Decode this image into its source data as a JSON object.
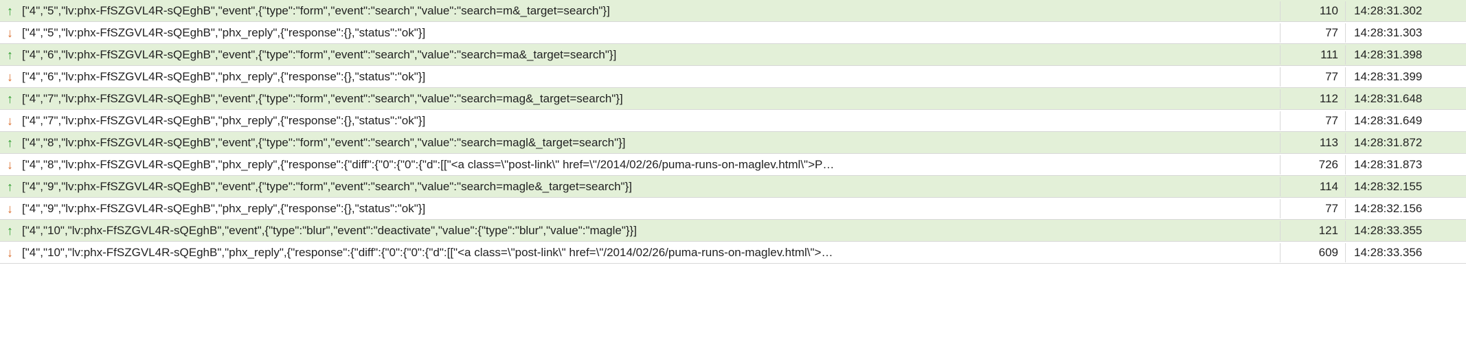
{
  "rows": [
    {
      "direction": "out",
      "arrow": "↑",
      "payload": "[\"4\",\"5\",\"lv:phx-FfSZGVL4R-sQEghB\",\"event\",{\"type\":\"form\",\"event\":\"search\",\"value\":\"search=m&_target=search\"}]",
      "size": "110",
      "time": "14:28:31.302"
    },
    {
      "direction": "in",
      "arrow": "↓",
      "payload": "[\"4\",\"5\",\"lv:phx-FfSZGVL4R-sQEghB\",\"phx_reply\",{\"response\":{},\"status\":\"ok\"}]",
      "size": "77",
      "time": "14:28:31.303"
    },
    {
      "direction": "out",
      "arrow": "↑",
      "payload": "[\"4\",\"6\",\"lv:phx-FfSZGVL4R-sQEghB\",\"event\",{\"type\":\"form\",\"event\":\"search\",\"value\":\"search=ma&_target=search\"}]",
      "size": "111",
      "time": "14:28:31.398"
    },
    {
      "direction": "in",
      "arrow": "↓",
      "payload": "[\"4\",\"6\",\"lv:phx-FfSZGVL4R-sQEghB\",\"phx_reply\",{\"response\":{},\"status\":\"ok\"}]",
      "size": "77",
      "time": "14:28:31.399"
    },
    {
      "direction": "out",
      "arrow": "↑",
      "payload": "[\"4\",\"7\",\"lv:phx-FfSZGVL4R-sQEghB\",\"event\",{\"type\":\"form\",\"event\":\"search\",\"value\":\"search=mag&_target=search\"}]",
      "size": "112",
      "time": "14:28:31.648"
    },
    {
      "direction": "in",
      "arrow": "↓",
      "payload": "[\"4\",\"7\",\"lv:phx-FfSZGVL4R-sQEghB\",\"phx_reply\",{\"response\":{},\"status\":\"ok\"}]",
      "size": "77",
      "time": "14:28:31.649"
    },
    {
      "direction": "out",
      "arrow": "↑",
      "payload": "[\"4\",\"8\",\"lv:phx-FfSZGVL4R-sQEghB\",\"event\",{\"type\":\"form\",\"event\":\"search\",\"value\":\"search=magl&_target=search\"}]",
      "size": "113",
      "time": "14:28:31.872"
    },
    {
      "direction": "in",
      "arrow": "↓",
      "payload": "[\"4\",\"8\",\"lv:phx-FfSZGVL4R-sQEghB\",\"phx_reply\",{\"response\":{\"diff\":{\"0\":{\"0\":{\"d\":[[\"<a class=\\\"post-link\\\" href=\\\"/2014/02/26/puma-runs-on-maglev.html\\\">P…",
      "size": "726",
      "time": "14:28:31.873"
    },
    {
      "direction": "out",
      "arrow": "↑",
      "payload": "[\"4\",\"9\",\"lv:phx-FfSZGVL4R-sQEghB\",\"event\",{\"type\":\"form\",\"event\":\"search\",\"value\":\"search=magle&_target=search\"}]",
      "size": "114",
      "time": "14:28:32.155"
    },
    {
      "direction": "in",
      "arrow": "↓",
      "payload": "[\"4\",\"9\",\"lv:phx-FfSZGVL4R-sQEghB\",\"phx_reply\",{\"response\":{},\"status\":\"ok\"}]",
      "size": "77",
      "time": "14:28:32.156"
    },
    {
      "direction": "out",
      "arrow": "↑",
      "payload": "[\"4\",\"10\",\"lv:phx-FfSZGVL4R-sQEghB\",\"event\",{\"type\":\"blur\",\"event\":\"deactivate\",\"value\":{\"type\":\"blur\",\"value\":\"magle\"}}]",
      "size": "121",
      "time": "14:28:33.355"
    },
    {
      "direction": "in",
      "arrow": "↓",
      "payload": "[\"4\",\"10\",\"lv:phx-FfSZGVL4R-sQEghB\",\"phx_reply\",{\"response\":{\"diff\":{\"0\":{\"0\":{\"d\":[[\"<a class=\\\"post-link\\\" href=\\\"/2014/02/26/puma-runs-on-maglev.html\\\">…",
      "size": "609",
      "time": "14:28:33.356"
    }
  ]
}
